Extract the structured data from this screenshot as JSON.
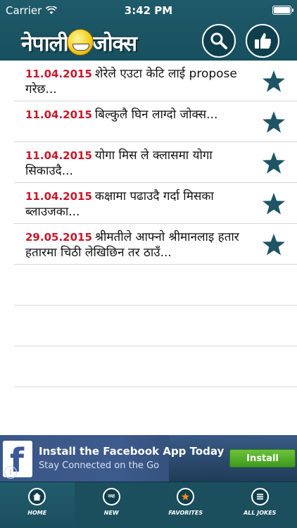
{
  "status_bar": {
    "carrier": "Carrier",
    "time": "3:42 PM"
  },
  "header": {
    "logo_text_left": "नेपाली",
    "logo_text_right": "जोक्स"
  },
  "jokes": [
    {
      "date": "11.04.2015",
      "text": "शेरेले एउटा केटि लाई propose गरेछ..."
    },
    {
      "date": "11.04.2015",
      "text": "बिल्कुलै घिन लाग्दो जोक्स..."
    },
    {
      "date": "11.04.2015",
      "text": "योगा मिस ले क्लासमा योगा सिकाउदै..."
    },
    {
      "date": "11.04.2015",
      "text": "कक्षामा पढाउदै गर्दा मिसका ब्लाउजका..."
    },
    {
      "date": "29.05.2015",
      "text": "श्रीमतीले आफ्नो श्रीमानलाइ हतार हतारमा चिठी लेखिछिन तर ठाउँ..."
    }
  ],
  "ad": {
    "title": "Install the Facebook App Today",
    "subtitle": "Stay Connected on the Go",
    "button": "Install"
  },
  "tabs": [
    {
      "label": "HOME"
    },
    {
      "label": "NEW",
      "badge": "नया"
    },
    {
      "label": "FAVORITES"
    },
    {
      "label": "ALL JOKES"
    }
  ],
  "colors": {
    "header_bg": "#1f5a6a",
    "date_red": "#c9172a",
    "star_teal": "#1d5566",
    "tab_bg": "#1b4f5e"
  }
}
